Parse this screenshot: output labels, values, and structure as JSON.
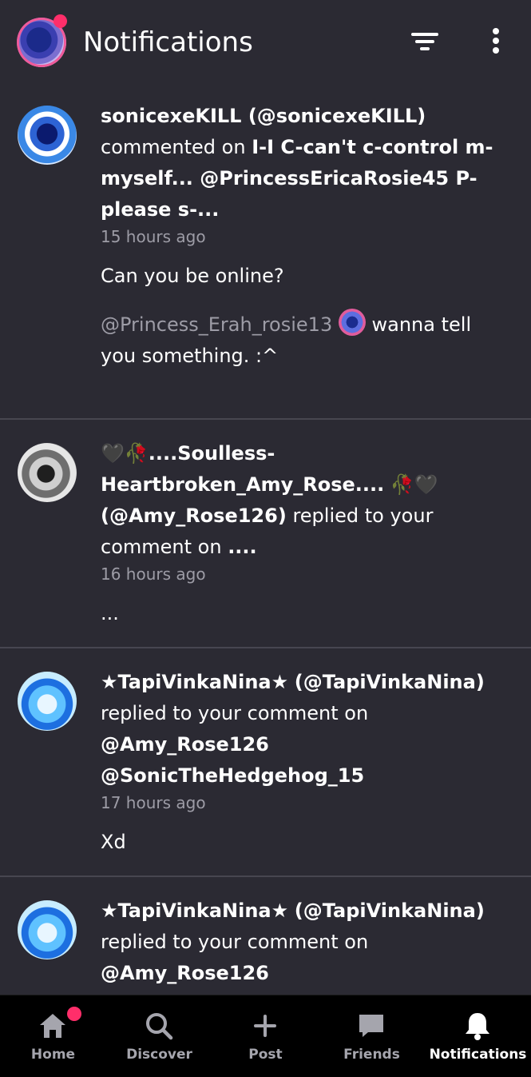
{
  "header": {
    "title": "Notifications",
    "icons": [
      "filter-icon",
      "more-vertical-icon"
    ]
  },
  "notifications": [
    {
      "user_display": "sonicexeKILL (@sonicexeKILL)",
      "action": "commented on",
      "target": "I-I C-can't c-control m-myself... @PrincessEricaRosie45 P-please s-...",
      "time": "15 hours ago",
      "message": "Can you be online?",
      "reply_mention": "@Princess_Erah_rosie13",
      "reply_text": "wanna tell you something. :^"
    },
    {
      "name_prefix_emoji": "🖤🥀",
      "user_name": "....Soulless-Heartbroken_Amy_Rose....",
      "name_suffix_emoji": "🥀🖤",
      "handle": "(@Amy_Rose126)",
      "action": "replied to your comment on",
      "target": "....",
      "time": "16 hours ago",
      "message": "..."
    },
    {
      "user_name": "★TapiVinkaNina★",
      "handle": "(@TapiVinkaNina)",
      "action": "replied to your comment on",
      "target": "@Amy_Rose126 @SonicTheHedgehog_15",
      "time": "17 hours ago",
      "message": "Xd"
    },
    {
      "user_name": "★TapiVinkaNina★",
      "handle": "(@TapiVinkaNina)",
      "action": "replied to your comment on",
      "target": "@Amy_Rose126"
    }
  ],
  "nav": {
    "home": "Home",
    "discover": "Discover",
    "post": "Post",
    "friends": "Friends",
    "notifications": "Notifications",
    "active": "notifications"
  },
  "colors": {
    "background": "#2b2a33",
    "divider": "#474650",
    "muted_text": "#9d9ca6",
    "badge": "#ff2e6a",
    "nav_background": "#000000"
  }
}
